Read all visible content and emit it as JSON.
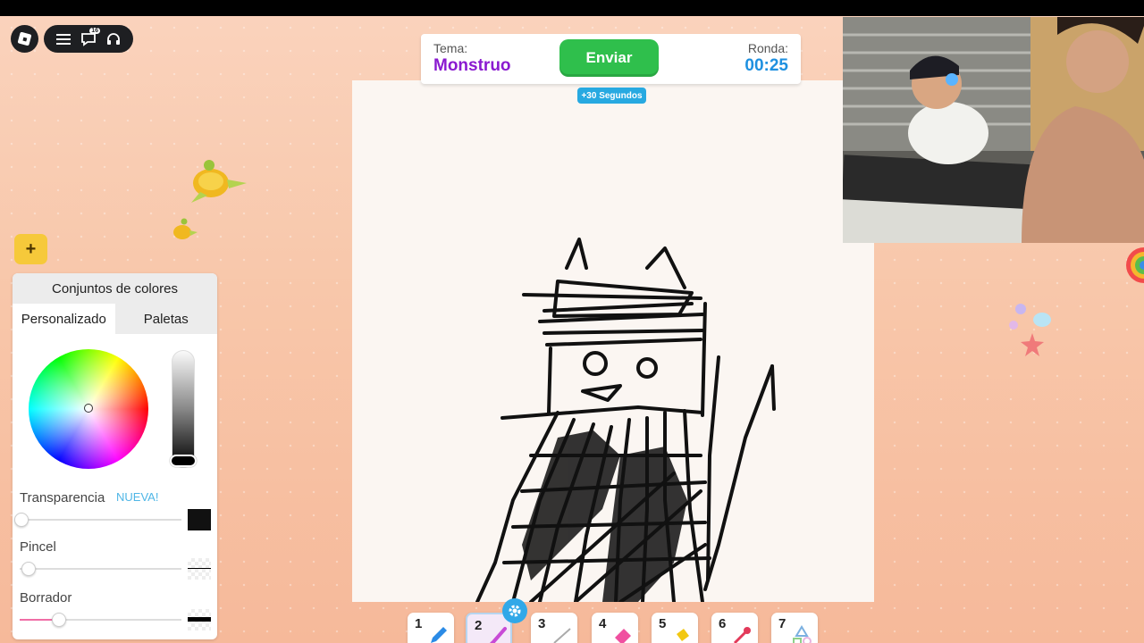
{
  "app": {
    "menu_badge": "16"
  },
  "header": {
    "topic_label": "Tema:",
    "topic_value": "Monstruo",
    "send_label": "Enviar",
    "round_label": "Ronda:",
    "round_timer": "00:25",
    "bonus_label": "+30 Segundos"
  },
  "color_panel": {
    "title": "Conjuntos de colores",
    "tabs": [
      {
        "label": "Personalizado",
        "active": true
      },
      {
        "label": "Paletas",
        "active": false
      }
    ],
    "transparency_label": "Transparencia",
    "new_badge": "NUEVA!",
    "brush_label": "Pincel",
    "eraser_label": "Borrador",
    "selected_color": "#111111",
    "eraser_track_color": "#f06ea6"
  },
  "plus_button": {
    "label": "+"
  },
  "tools": [
    {
      "num": "1",
      "icon": "pencil-icon",
      "color": "#2b8be6"
    },
    {
      "num": "2",
      "icon": "brush-icon",
      "color": "#c84bd6",
      "selected": true
    },
    {
      "num": "3",
      "icon": "line-icon",
      "color": "#aaaaaa"
    },
    {
      "num": "4",
      "icon": "eraser-icon",
      "color": "#f04fa0"
    },
    {
      "num": "5",
      "icon": "bucket-icon",
      "color": "#f2c811"
    },
    {
      "num": "6",
      "icon": "eyedropper-icon",
      "color": "#e23a5a"
    },
    {
      "num": "7",
      "icon": "shapes-icon",
      "color": "#7bb0e0"
    }
  ],
  "colors": {
    "topic": "#8a1ad0",
    "timer": "#1e90e0",
    "send_button": "#2fbf4c",
    "bonus_badge": "#27a9e1",
    "plus_button": "#f6c93a"
  }
}
